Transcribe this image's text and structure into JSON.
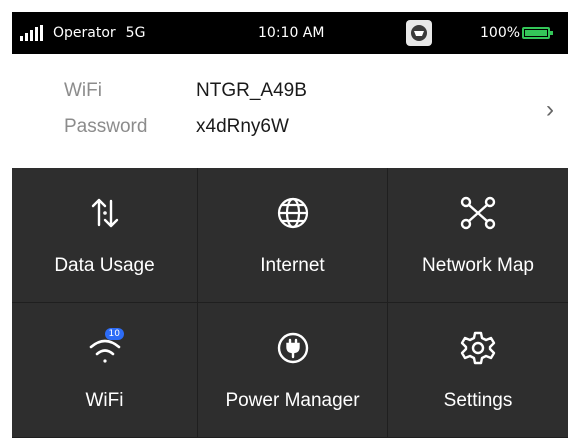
{
  "status": {
    "operator": "Operator",
    "network": "5G",
    "time": "10:10 AM",
    "battery_pct": "100%",
    "battery_level": 1.0,
    "battery_color": "#34c759",
    "tray_icon": "tray-app-icon"
  },
  "wifi": {
    "ssid_label": "WiFi",
    "ssid": "NTGR_A49B",
    "password_label": "Password",
    "password": "x4dRny6W",
    "chevron_icon": "chevron-right-icon"
  },
  "tiles": [
    {
      "label": "Data Usage",
      "icon": "data-usage-icon"
    },
    {
      "label": "Internet",
      "icon": "globe-icon"
    },
    {
      "label": "Network Map",
      "icon": "network-map-icon"
    },
    {
      "label": "WiFi",
      "icon": "wifi-icon",
      "badge": "10"
    },
    {
      "label": "Power Manager",
      "icon": "power-plug-icon"
    },
    {
      "label": "Settings",
      "icon": "gear-icon"
    }
  ],
  "colors": {
    "status_bg": "#000000",
    "grid_bg": "#2e2e2e",
    "badge": "#2d6cf6"
  }
}
